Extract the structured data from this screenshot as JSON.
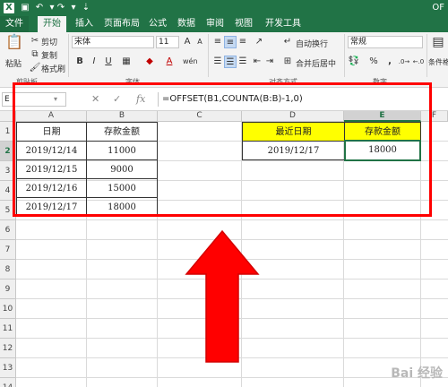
{
  "window": {
    "title": "OF"
  },
  "tabs": [
    {
      "label": "文件"
    },
    {
      "label": "开始"
    },
    {
      "label": "插入"
    },
    {
      "label": "页面布局"
    },
    {
      "label": "公式"
    },
    {
      "label": "数据"
    },
    {
      "label": "审阅"
    },
    {
      "label": "视图"
    },
    {
      "label": "开发工具"
    }
  ],
  "ribbon": {
    "clipboard": {
      "paste": "粘贴",
      "cut": "剪切",
      "copy": "复制",
      "format_painter": "格式刷",
      "group": "剪贴板"
    },
    "font": {
      "name": "宋体",
      "size": "11",
      "group": "字体",
      "bold": "B",
      "italic": "I",
      "underline": "U",
      "font_color_glyph": "A",
      "wen": "wén"
    },
    "alignment": {
      "wrap": "自动换行",
      "merge": "合并后居中",
      "group": "对齐方式"
    },
    "number": {
      "format": "常规",
      "percent": "%",
      "comma": ",",
      "group": "数字"
    },
    "styles": {
      "conditional": "条件格"
    }
  },
  "formula_bar": {
    "name_box": "E",
    "cancel": "✕",
    "enter": "✓",
    "fx": "fx",
    "formula": "=OFFSET(B1,COUNTA(B:B)-1,0)"
  },
  "columns": [
    "A",
    "B",
    "C",
    "D",
    "E",
    "F"
  ],
  "rows": [
    "1",
    "2",
    "3",
    "4",
    "5",
    "6",
    "7",
    "8",
    "9",
    "10",
    "11",
    "12",
    "13",
    "14"
  ],
  "table": {
    "header": [
      "日期",
      "存款金额"
    ],
    "rows": [
      [
        "2019/12/14",
        "11000"
      ],
      [
        "2019/12/15",
        "9000"
      ],
      [
        "2019/12/16",
        "15000"
      ],
      [
        "2019/12/17",
        "18000"
      ]
    ]
  },
  "result": {
    "header": [
      "最近日期",
      "存款金额"
    ],
    "values": [
      "2019/12/17",
      "18000"
    ]
  },
  "colors": {
    "excel_green": "#217346",
    "highlight_red": "#ff0000",
    "header_yellow": "#ffff00"
  },
  "watermark": "Bai 经验"
}
